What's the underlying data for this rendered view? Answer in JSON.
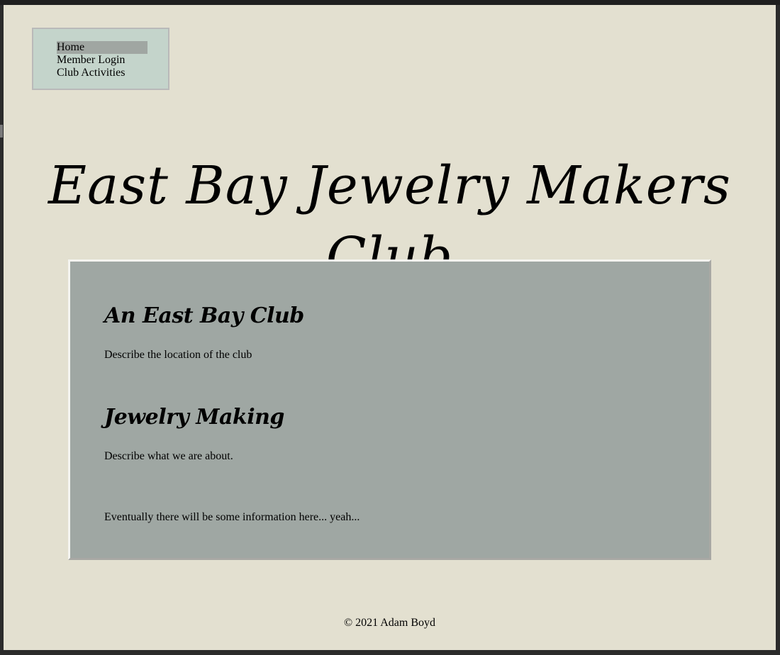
{
  "nav": {
    "items": [
      {
        "label": "Home",
        "active": true
      },
      {
        "label": "Member Login",
        "active": false
      },
      {
        "label": "Club Activities",
        "active": false
      }
    ]
  },
  "header": {
    "title": "East Bay Jewelry Makers Club"
  },
  "main": {
    "sections": [
      {
        "heading": "An East Bay Club",
        "text": "Describe the location of the club"
      },
      {
        "heading": "Jewelry Making",
        "text": "Describe what we are about."
      }
    ],
    "note": "Eventually there will be some information here... yeah..."
  },
  "footer": {
    "copyright": "© 2021 Adam Boyd"
  },
  "colors": {
    "page_background": "#e3e0d0",
    "nav_background": "#c4d4cb",
    "nav_active": "#a0a6a2",
    "content_background": "#9fa7a3"
  }
}
